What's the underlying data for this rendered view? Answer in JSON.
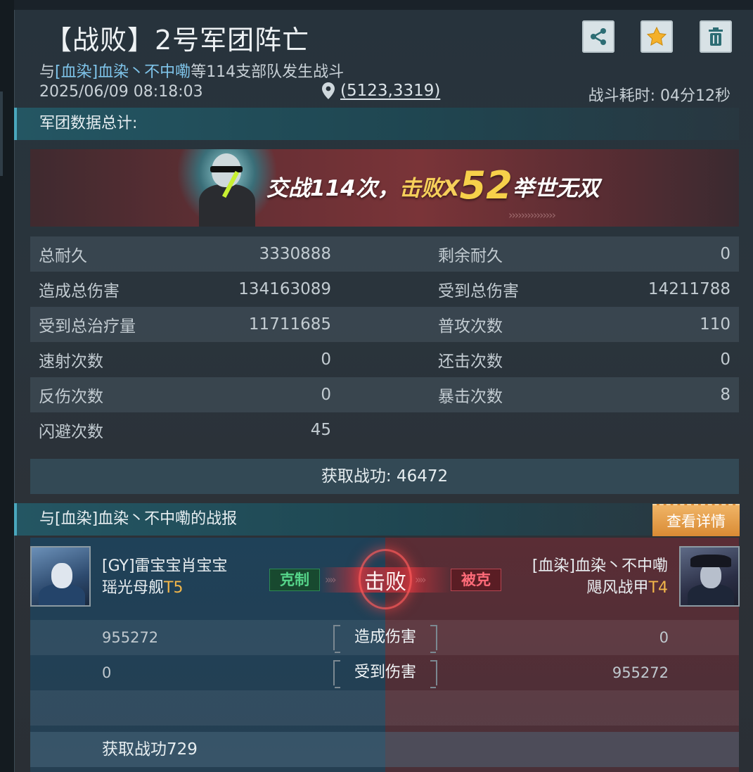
{
  "header": {
    "title": "【战败】2号军团阵亡",
    "subtitle_prefix": "与",
    "subtitle_highlight": "[血染]血染丶不中嘞",
    "subtitle_suffix": "等114支部队发生战斗",
    "datetime": "2025/06/09  08:18:03",
    "coordinates": "(5123,3319)",
    "duration_label": "战斗耗时:  04分12秒"
  },
  "toolbar": {
    "share_icon": "share-icon",
    "favorite_icon": "star-icon",
    "delete_icon": "trash-icon"
  },
  "summary": {
    "section_title": "军团数据总计:",
    "banner": {
      "text_a": "交战114次，",
      "text_b": "击败X",
      "kills": "52",
      "text_c": "举世无双"
    },
    "stats": [
      {
        "left_label": "总耐久",
        "left_value": "3330888",
        "right_label": "剩余耐久",
        "right_value": "0"
      },
      {
        "left_label": "造成总伤害",
        "left_value": "134163089",
        "right_label": "受到总伤害",
        "right_value": "14211788"
      },
      {
        "left_label": "受到总治疗量",
        "left_value": "11711685",
        "right_label": "普攻次数",
        "right_value": "110"
      },
      {
        "left_label": "速射次数",
        "left_value": "0",
        "right_label": "还击次数",
        "right_value": "0"
      },
      {
        "left_label": "反伤次数",
        "left_value": "0",
        "right_label": "暴击次数",
        "right_value": "8"
      },
      {
        "left_label": "闪避次数",
        "left_value": "45",
        "right_label": "",
        "right_value": ""
      }
    ],
    "merit": "获取战功:  46472"
  },
  "report": {
    "section_title": "与[血染]血染丶不中嘞的战报",
    "detail_button": "查看详情",
    "left": {
      "player": "[GY]雷宝宝肖宝宝",
      "unit": "瑶光母舰",
      "tier": "T5",
      "tag": "克制"
    },
    "right": {
      "player": "[血染]血染丶不中嘞",
      "unit": "飓风战甲",
      "tier": "T4",
      "tag": "被克"
    },
    "result": "击败",
    "rows": [
      {
        "label": "造成伤害",
        "left": "955272",
        "right": "0"
      },
      {
        "label": "受到伤害",
        "left": "0",
        "right": "955272"
      }
    ],
    "merit": "获取战功729"
  },
  "colors": {
    "accent_teal": "#4aa7bd",
    "tier_gold": "#f2b64a",
    "win_green": "#56d58a",
    "lose_red": "#ff6b79",
    "highlight_blue": "#7fc4ea",
    "detail_orange": "#d98b34"
  }
}
